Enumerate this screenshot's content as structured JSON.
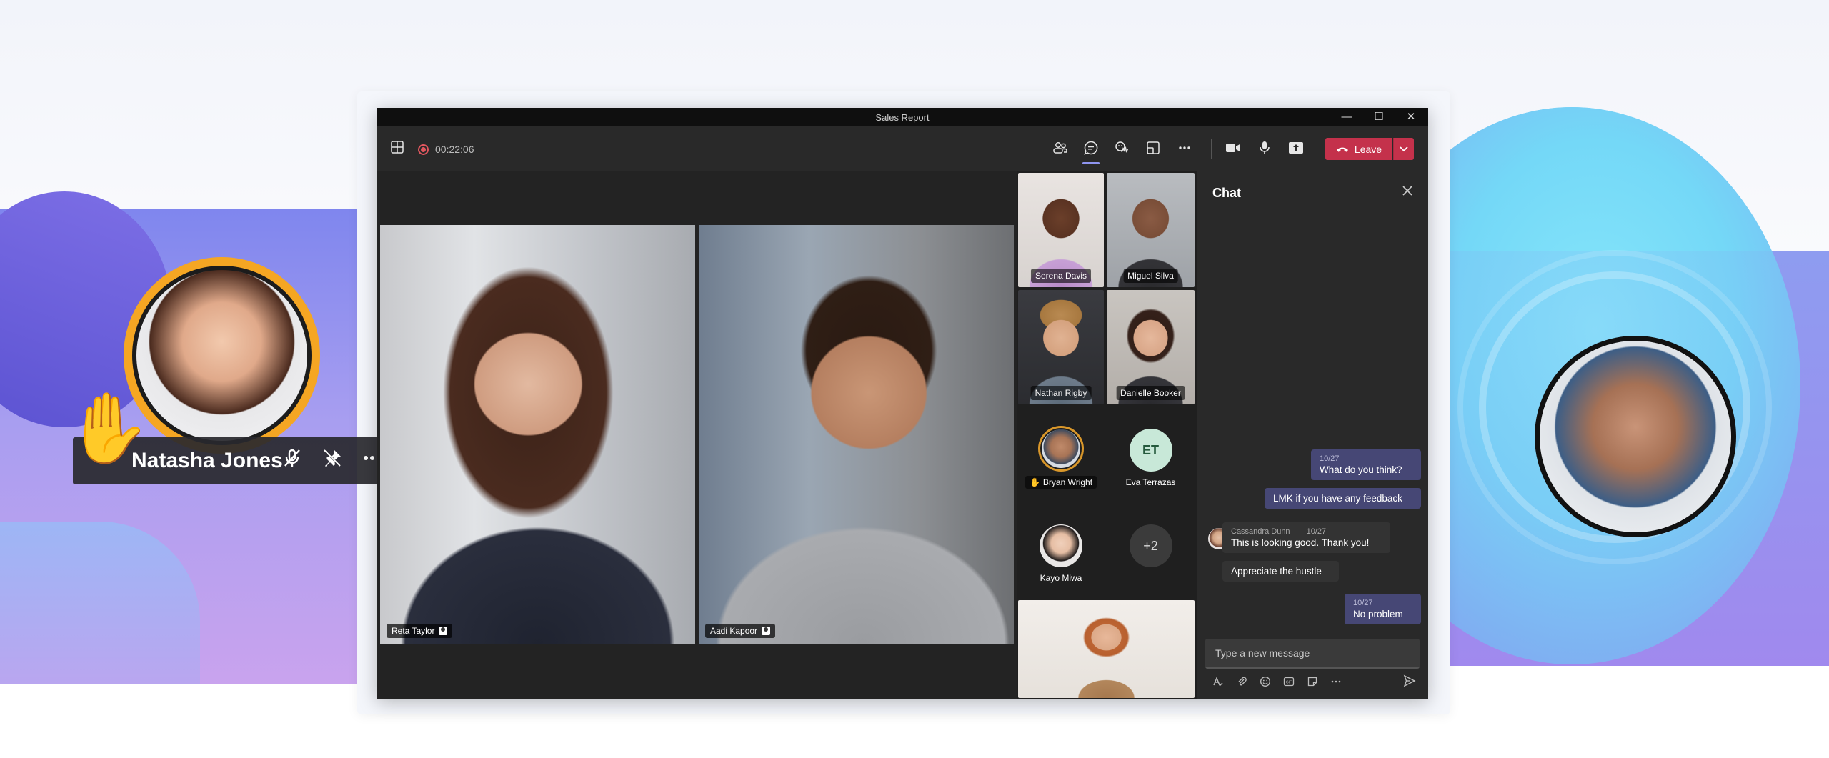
{
  "window": {
    "title": "Sales Report",
    "controls": {
      "minimize": "—",
      "maximize": "☐",
      "close": "✕"
    }
  },
  "toolbar": {
    "timer": "00:22:06",
    "leave_label": "Leave",
    "icons": [
      "grid-icon",
      "people-icon",
      "chat-icon",
      "reactions-icon",
      "rooms-icon",
      "more-icon",
      "camera-icon",
      "mic-icon",
      "share-icon",
      "phone-icon",
      "chevron-down-icon"
    ]
  },
  "stage": {
    "participants": [
      {
        "name": "Reta Taylor"
      },
      {
        "name": "Aadi Kapoor"
      }
    ]
  },
  "gallery": {
    "tiles": [
      {
        "name": "Serena Davis"
      },
      {
        "name": "Miguel Silva"
      },
      {
        "name": "Nathan Rigby"
      },
      {
        "name": "Danielle Booker"
      }
    ],
    "avatars": [
      {
        "name": "Bryan Wright"
      },
      {
        "name": "Eva Terrazas",
        "initials": "ET"
      },
      {
        "name": "Kayo Miwa"
      },
      {
        "name": "",
        "more": "+2"
      }
    ]
  },
  "chat": {
    "title": "Chat",
    "messages": [
      {
        "from": "me",
        "date": "10/27",
        "text": "What do you think?"
      },
      {
        "from": "me",
        "date": "",
        "text": "LMK if you have any feedback"
      },
      {
        "from": "Cassandra Dunn",
        "date": "10/27",
        "text": "This is looking good. Thank you!"
      },
      {
        "from": "Cassandra Dunn",
        "date": "",
        "text": "Appreciate the hustle"
      },
      {
        "from": "me",
        "date": "10/27",
        "text": "No problem"
      }
    ],
    "compose_placeholder": "Type a new message",
    "compose_tools": [
      "format-icon",
      "attach-icon",
      "emoji-icon",
      "gif-icon",
      "sticker-icon",
      "more-icon"
    ],
    "gif_label": "GIF"
  },
  "floating": {
    "name": "Natasha Jones"
  },
  "colors": {
    "leave": "#c4314b",
    "accent": "#8f95f0",
    "raised_hand_ring": "#f5a623",
    "my_bubble": "#464775"
  }
}
